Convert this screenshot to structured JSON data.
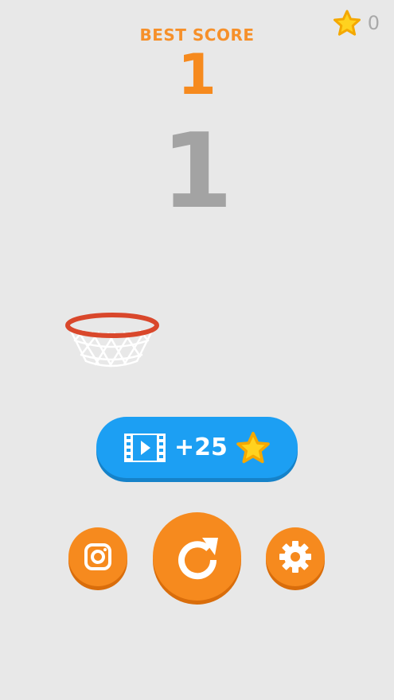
{
  "header": {
    "star_count": "0",
    "best_score_label": "BEST SCORE",
    "best_score_value": "1"
  },
  "game": {
    "current_score": "1"
  },
  "video_reward": {
    "amount_label": "+25"
  },
  "icons": {
    "star": "star-icon",
    "film": "film-icon",
    "instagram": "instagram-icon",
    "restart": "restart-icon",
    "settings": "gear-icon",
    "hoop": "basketball-hoop-icon"
  },
  "colors": {
    "background": "#e8e8e8",
    "accent_orange": "#f68a1e",
    "button_blue": "#1c9ff3",
    "star_yellow": "#ffd21f",
    "score_gray": "#a3a3a3",
    "rim_red": "#d9472b"
  }
}
